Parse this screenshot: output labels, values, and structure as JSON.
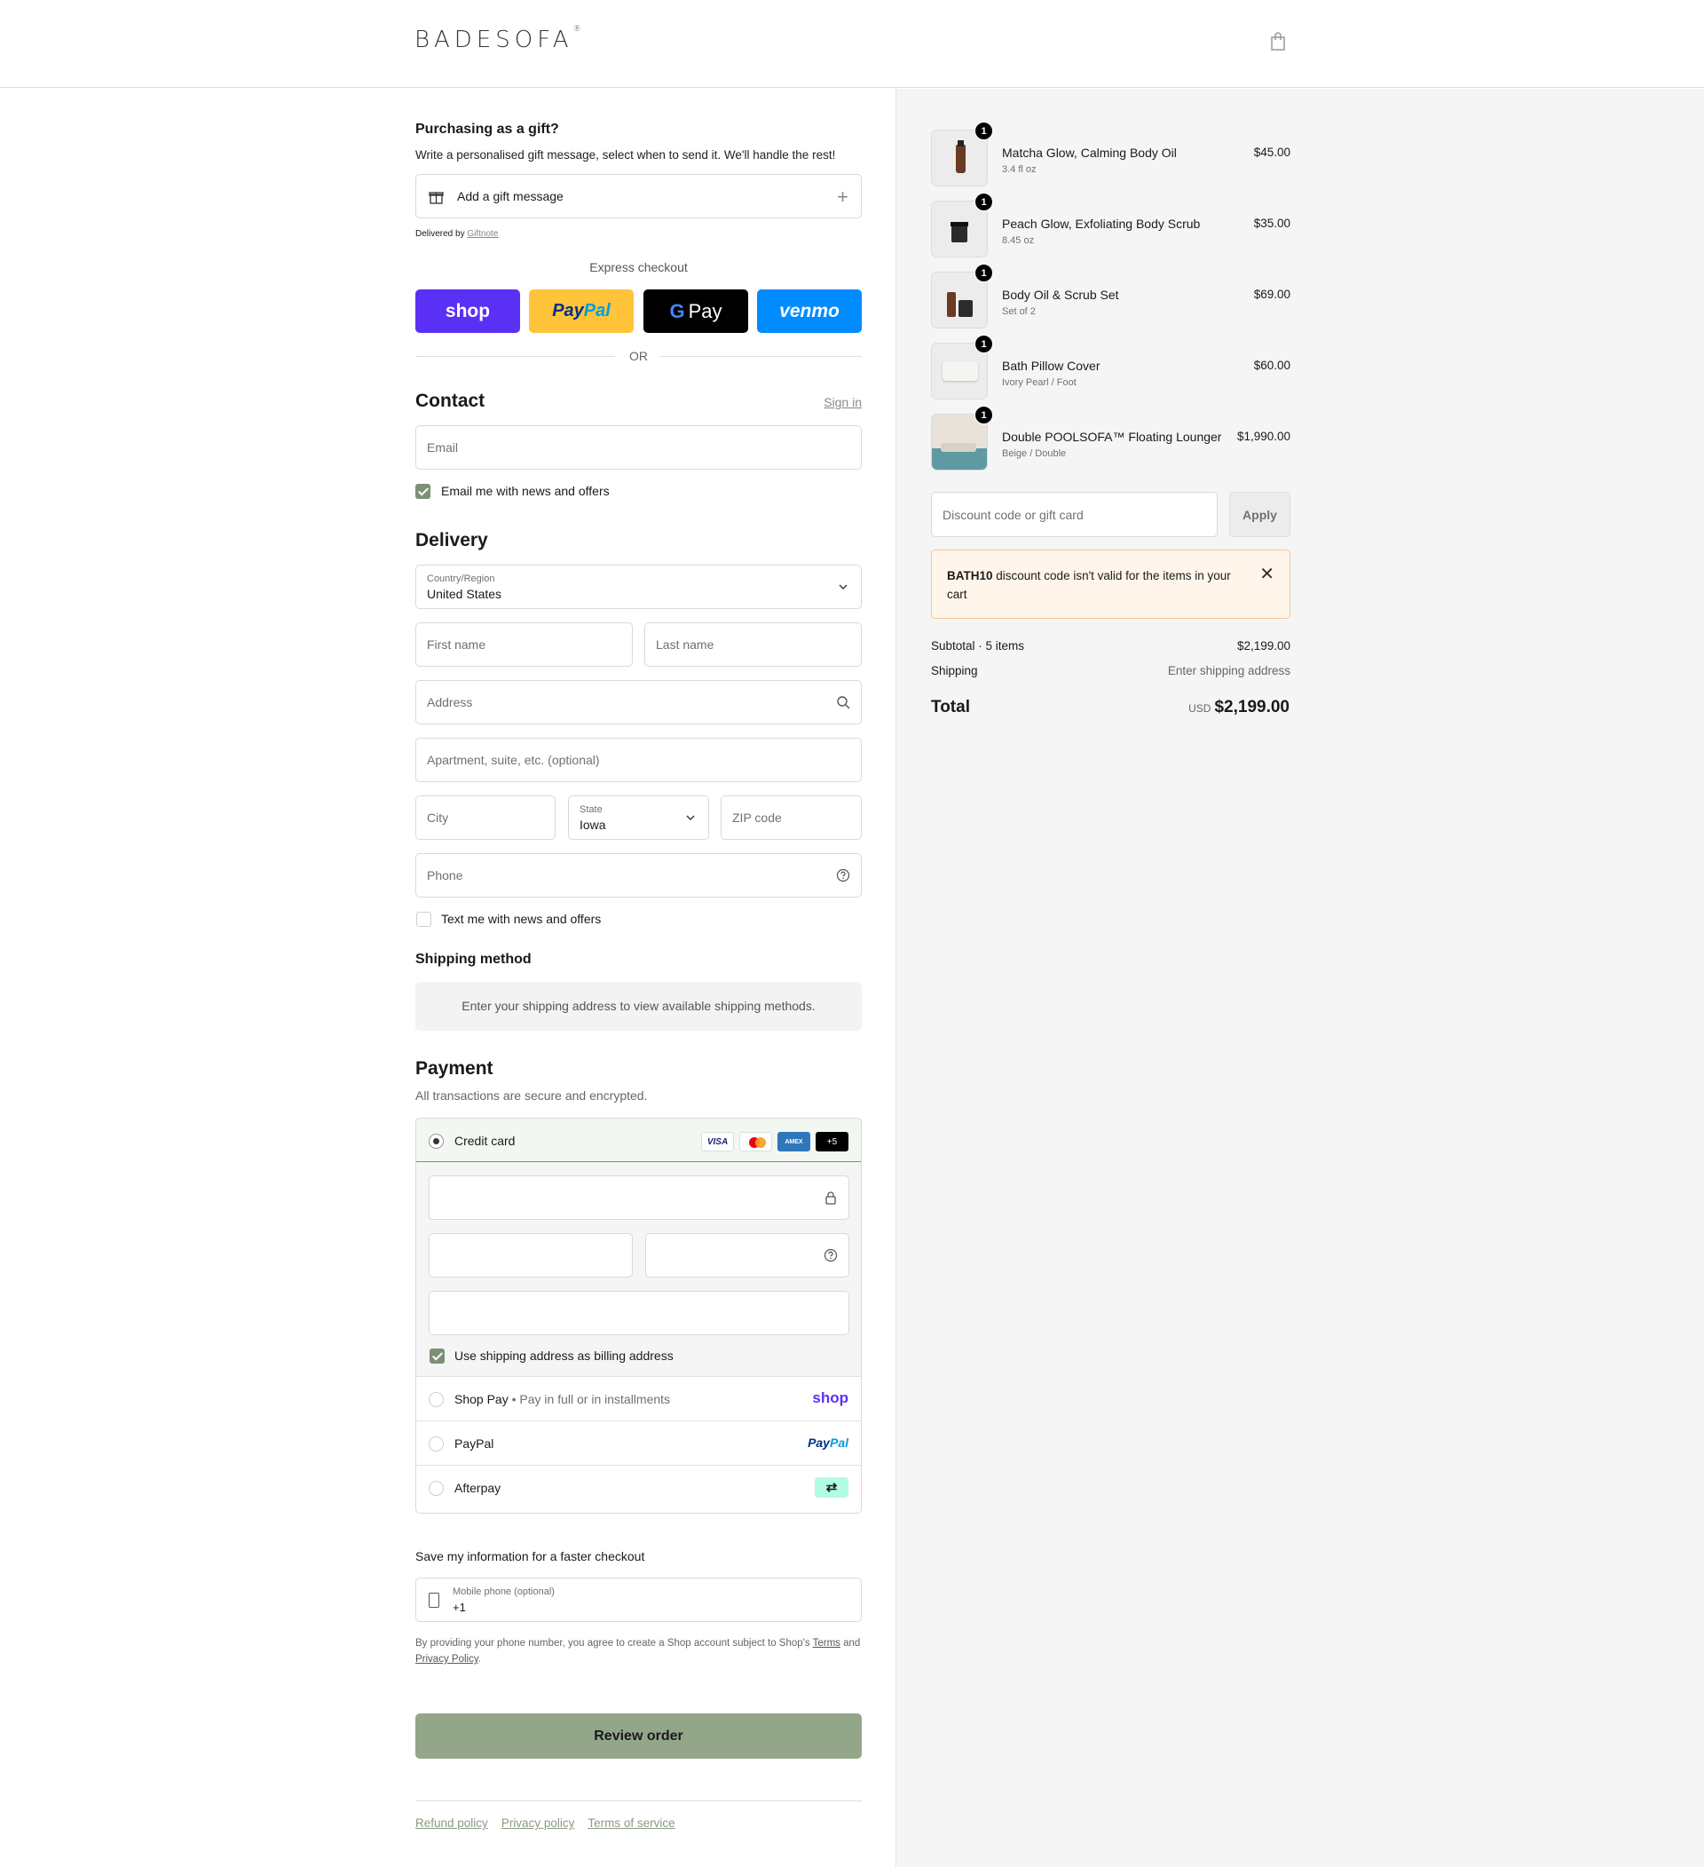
{
  "header": {
    "logo": "BADESOFA",
    "logo_mark": "®",
    "cart_icon": "shopping-bag-icon"
  },
  "gift": {
    "title": "Purchasing as a gift?",
    "subtitle": "Write a personalised gift message, select when to send it. We'll handle the rest!",
    "add_label": "Add a gift message",
    "add_icon": "plus-icon",
    "delivered_by": "Delivered by",
    "provider": "Giftnote"
  },
  "express": {
    "title": "Express checkout",
    "buttons": [
      {
        "label": "shop"
      },
      {
        "label_a": "Pay",
        "label_b": "Pal"
      },
      {
        "label_g": "G",
        "label": "Pay"
      },
      {
        "label": "venmo"
      }
    ],
    "or": "OR"
  },
  "contact": {
    "title": "Contact",
    "sign_in": "Sign in",
    "email_placeholder": "Email",
    "news_label": "Email me with news and offers",
    "news_checked": true
  },
  "delivery": {
    "title": "Delivery",
    "country_label": "Country/Region",
    "country_value": "United States",
    "first_name": "First name",
    "last_name": "Last name",
    "address": "Address",
    "apartment": "Apartment, suite, etc. (optional)",
    "city": "City",
    "state_label": "State",
    "state_value": "Iowa",
    "zip": "ZIP code",
    "phone": "Phone",
    "text_label": "Text me with news and offers",
    "text_checked": false
  },
  "shipping": {
    "title": "Shipping method",
    "note": "Enter your shipping address to view available shipping methods."
  },
  "payment": {
    "title": "Payment",
    "subtitle": "All transactions are secure and encrypted.",
    "credit_card": "Credit card",
    "card_brands": [
      "VISA",
      "",
      "AMEX",
      "+5"
    ],
    "billing_label": "Use shipping address as billing address",
    "billing_checked": true,
    "shop_pay": "Shop Pay",
    "shop_pay_sep": "•",
    "shop_pay_sub": "Pay in full or in installments",
    "shop_brand": "shop",
    "paypal": "PayPal",
    "paypal_brand_a": "Pay",
    "paypal_brand_b": "Pal",
    "afterpay": "Afterpay",
    "afterpay_brand": "⇄"
  },
  "save_info": {
    "title": "Save my information for a faster checkout",
    "phone_label": "Mobile phone (optional)",
    "phone_value": "+1",
    "legal_a": "By providing your phone number, you agree to create a Shop account subject to Shop's ",
    "terms": "Terms",
    "legal_b": " and ",
    "privacy": "Privacy Policy",
    "legal_c": "."
  },
  "review": "Review order",
  "footer": [
    "Refund policy",
    "Privacy policy",
    "Terms of service"
  ],
  "summary": {
    "items": [
      {
        "name": "Matcha Glow, Calming Body Oil",
        "variant": "3.4 fl oz",
        "price": "$45.00",
        "qty": "1"
      },
      {
        "name": "Peach Glow, Exfoliating Body Scrub",
        "variant": "8.45 oz",
        "price": "$35.00",
        "qty": "1"
      },
      {
        "name": "Body Oil & Scrub Set",
        "variant": "Set of 2",
        "price": "$69.00",
        "qty": "1"
      },
      {
        "name": "Bath Pillow Cover",
        "variant": "Ivory Pearl / Foot",
        "price": "$60.00",
        "qty": "1"
      },
      {
        "name": "Double POOLSOFA™ Floating Lounger",
        "variant": "Beige / Double",
        "price": "$1,990.00",
        "qty": "1"
      }
    ],
    "discount_placeholder": "Discount code or gift card",
    "apply": "Apply",
    "alert_code": "BATH10",
    "alert_text": " discount code isn't valid for the items in your cart",
    "subtotal_label": "Subtotal · 5 items",
    "subtotal_value": "$2,199.00",
    "shipping_label": "Shipping",
    "shipping_value": "Enter shipping address",
    "total_label": "Total",
    "currency": "USD",
    "total_value": "$2,199.00"
  },
  "colors": {
    "accent": "#7d8f74",
    "review_button": "#94a68a",
    "shop_purple": "#5a31f4",
    "paypal_yellow": "#ffc439",
    "venmo_blue": "#008cff",
    "alert_bg": "#fff5ea"
  }
}
